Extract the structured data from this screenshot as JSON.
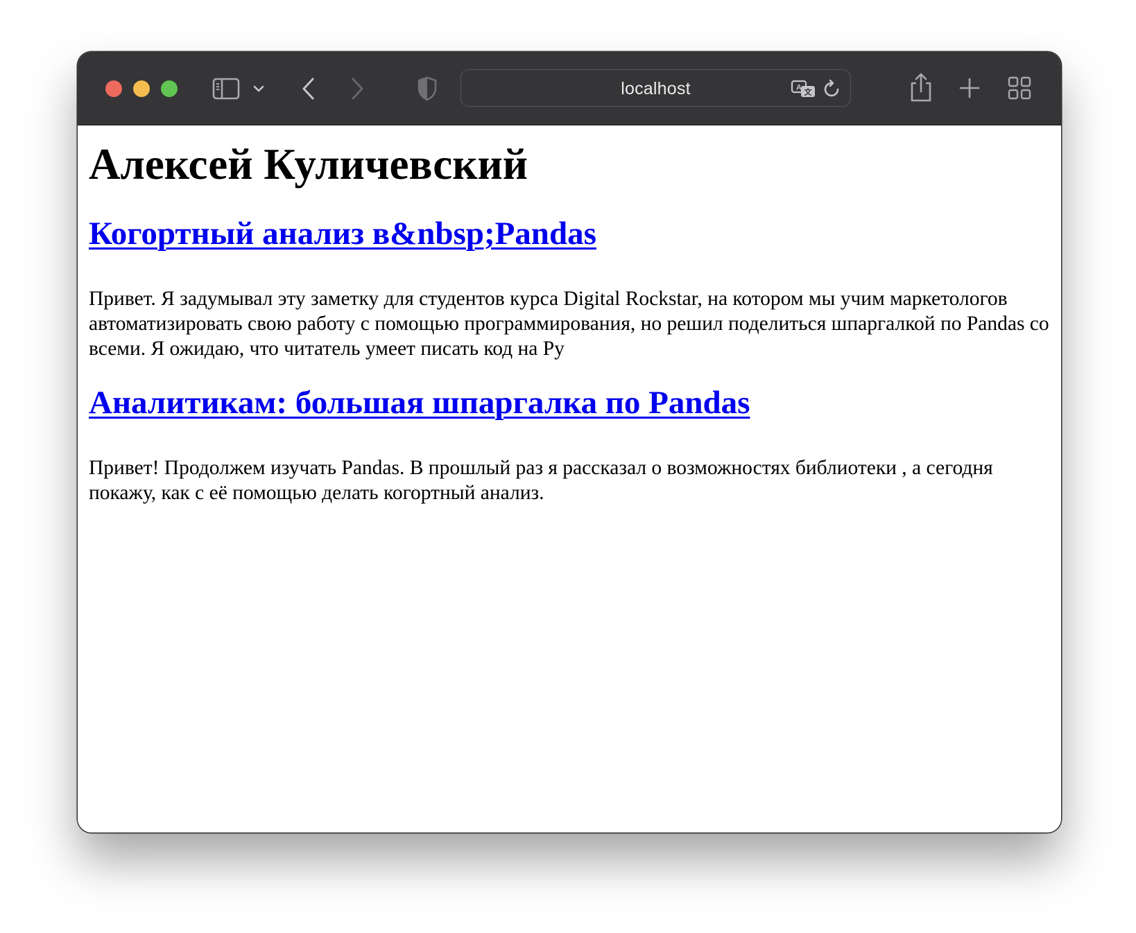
{
  "browser": {
    "address": "localhost",
    "icons": {
      "sidebar": "sidebar-icon",
      "chevron": "chevron-down-icon",
      "back": "back-arrow-icon",
      "forward": "forward-arrow-icon",
      "shield": "privacy-shield-icon",
      "translate": "translate-icon",
      "reload": "reload-icon",
      "share": "share-icon",
      "new_tab": "plus-icon",
      "tab_overview": "tab-grid-icon"
    },
    "colors": {
      "toolbar": "#353437",
      "close": "#ee6a5f",
      "minimize": "#f5bd4f",
      "zoom": "#61c554",
      "link": "#0000ee"
    }
  },
  "page": {
    "title": "Алексей Куличевский",
    "posts": [
      {
        "title": "Когортный анализ в&nbsp;Pandas",
        "excerpt": "Привет. Я задумывал эту заметку для студентов курса Digital Rockstar, на котором мы учим маркетологов автоматизировать свою работу с помощью программирования, но решил поделиться шпаргалкой по Pandas со всеми. Я ожидаю, что читатель умеет писать код на Py"
      },
      {
        "title": "Аналитикам: большая шпаргалка по Pandas",
        "excerpt": "Привет! Продолжем изучать Pandas. В прошлый раз я рассказал о возможностях библиотеки , а сегодня покажу, как с её помощью делать когортный анализ."
      }
    ]
  }
}
